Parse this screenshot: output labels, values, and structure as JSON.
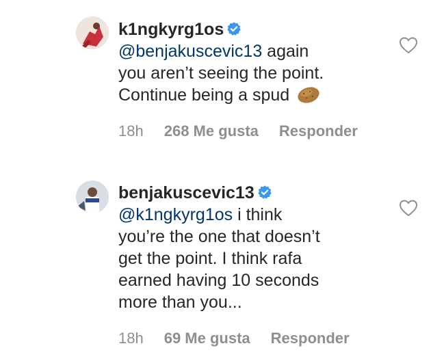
{
  "comments": [
    {
      "username": "k1ngkyrg1os",
      "verified": true,
      "mention": "@benjakuscevic13",
      "text_lines": [
        " again",
        "you aren’t seeing the point.",
        "Continue being a spud"
      ],
      "emoji": "potato-icon",
      "time": "18h",
      "likes": "268 Me gusta",
      "reply": "Responder"
    },
    {
      "username": "benjakuscevic13",
      "verified": true,
      "mention": "@k1ngkyrg1os",
      "text_lines": [
        " i think",
        "you’re the one that doesn’t",
        "get the point. I think rafa",
        "earned having 10 seconds",
        "more than you..."
      ],
      "time": "18h",
      "likes": "69 Me gusta",
      "reply": "Responder"
    }
  ],
  "colors": {
    "text": "#262626",
    "mention": "#00376b",
    "meta": "#8e8e8e",
    "verified": "#3897f0"
  }
}
